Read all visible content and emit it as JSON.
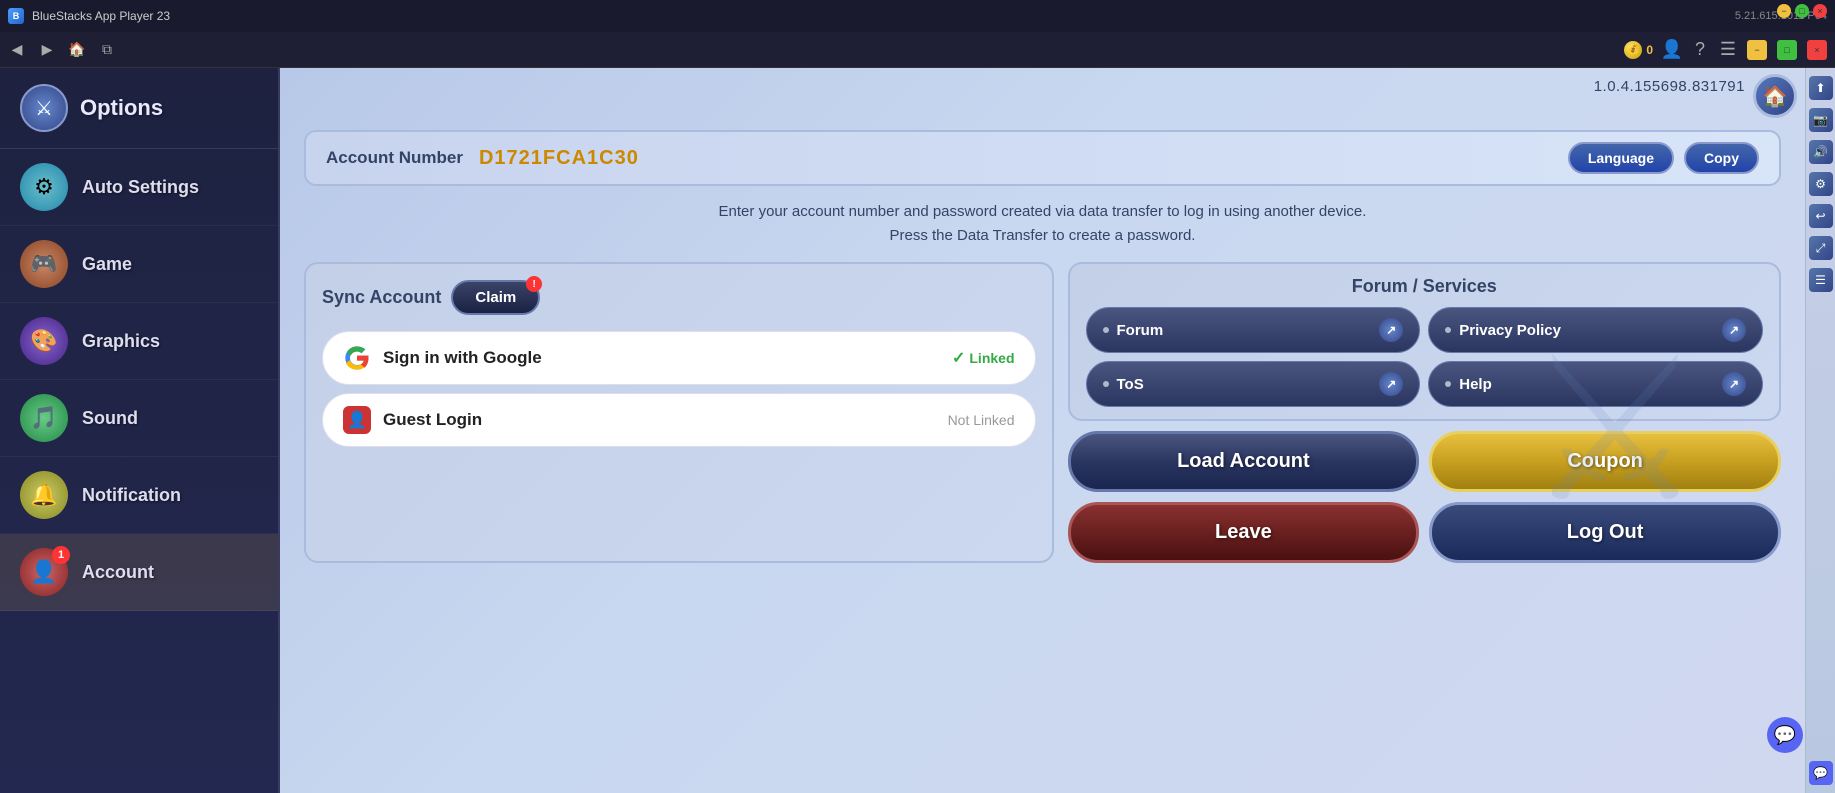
{
  "titlebar": {
    "app_name": "BlueStacks App Player 23",
    "version": "5.21.615.1011  P64"
  },
  "navbar": {
    "coin_count": "0"
  },
  "sidebar": {
    "title": "Options",
    "items": [
      {
        "id": "auto-settings",
        "label": "Auto Settings",
        "icon": "⚙"
      },
      {
        "id": "game",
        "label": "Game",
        "icon": "🎮"
      },
      {
        "id": "graphics",
        "label": "Graphics",
        "icon": "🎨"
      },
      {
        "id": "sound",
        "label": "Sound",
        "icon": "🎵"
      },
      {
        "id": "notification",
        "label": "Notification",
        "icon": "🔔"
      },
      {
        "id": "account",
        "label": "Account",
        "icon": "👤",
        "badge": "1"
      }
    ]
  },
  "content": {
    "version": "1.0.4.155698.831791",
    "account_number_label": "Account Number",
    "account_number_value": "D1721FCA1C30",
    "language_btn": "Language",
    "copy_btn": "Copy",
    "info_line1": "Enter your account number and password created via data transfer to log in using another device.",
    "info_line2": "Press the Data Transfer to create a password.",
    "left_panel": {
      "sync_label": "Sync Account",
      "claim_label": "Claim",
      "google_label": "Sign in with Google",
      "google_status": "Linked",
      "guest_label": "Guest Login",
      "guest_status": "Not Linked"
    },
    "right_panel": {
      "forum_services_label": "Forum / Services",
      "forum_btn": "Forum",
      "privacy_btn": "Privacy Policy",
      "tos_btn": "ToS",
      "help_btn": "Help",
      "load_account_btn": "Load Account",
      "coupon_btn": "Coupon",
      "leave_btn": "Leave",
      "logout_btn": "Log Out"
    }
  }
}
